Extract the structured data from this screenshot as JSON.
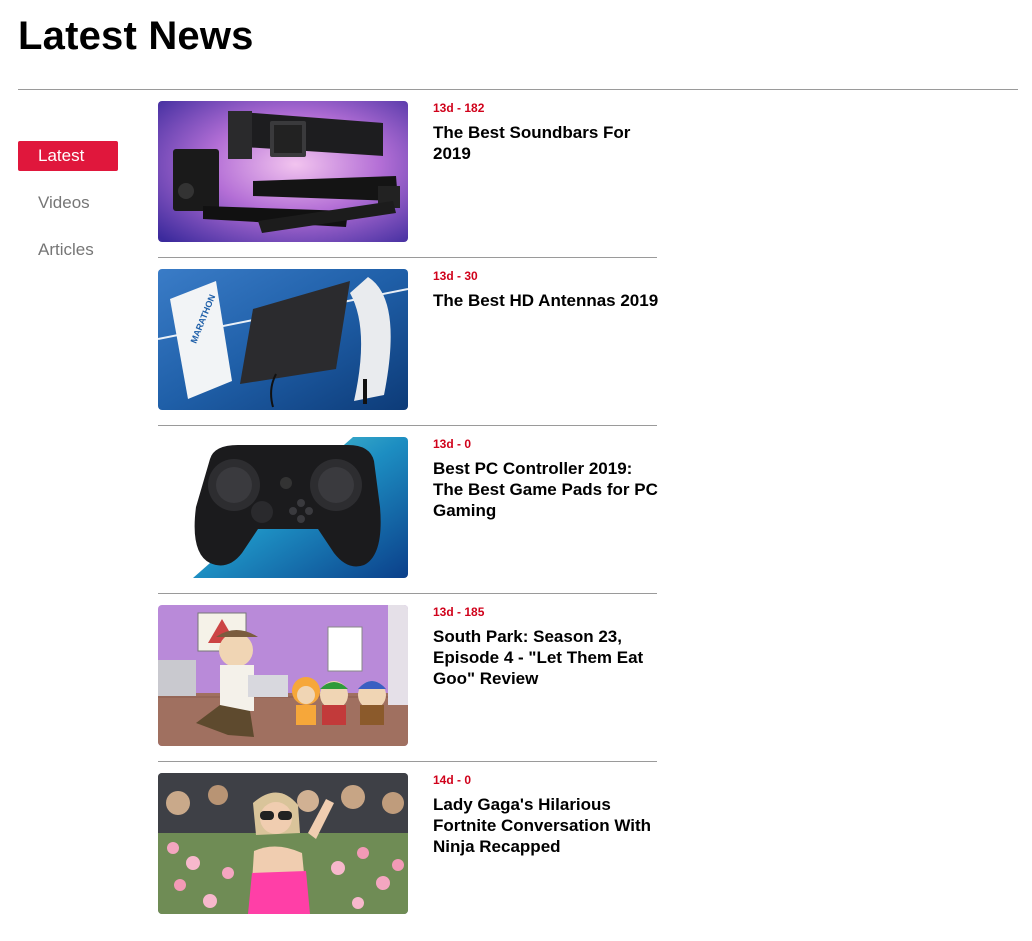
{
  "page": {
    "title": "Latest News"
  },
  "sidebar": {
    "items": [
      {
        "label": "Latest",
        "active": true
      },
      {
        "label": "Videos",
        "active": false
      },
      {
        "label": "Articles",
        "active": false
      }
    ]
  },
  "news": [
    {
      "meta": "13d - 182",
      "title": "The Best Soundbars For 2019",
      "image": "soundbars-thumbnail"
    },
    {
      "meta": "13d - 30",
      "title": "The Best HD Antennas 2019",
      "image": "hd-antennas-thumbnail"
    },
    {
      "meta": "13d - 0",
      "title": "Best PC Controller 2019: The Best Game Pads for PC Gaming",
      "image": "game-controller-thumbnail"
    },
    {
      "meta": "13d - 185",
      "title": "South Park: Season 23, Episode 4 - \"Let Them Eat Goo\" Review",
      "image": "south-park-thumbnail"
    },
    {
      "meta": "14d - 0",
      "title": "Lady Gaga's Hilarious Fortnite Conversation With Ninja Recapped",
      "image": "lady-gaga-thumbnail"
    }
  ],
  "colors": {
    "accent": "#e0173c",
    "meta": "#d0021b",
    "inactive": "#767676",
    "rule": "#9a9a9a"
  }
}
